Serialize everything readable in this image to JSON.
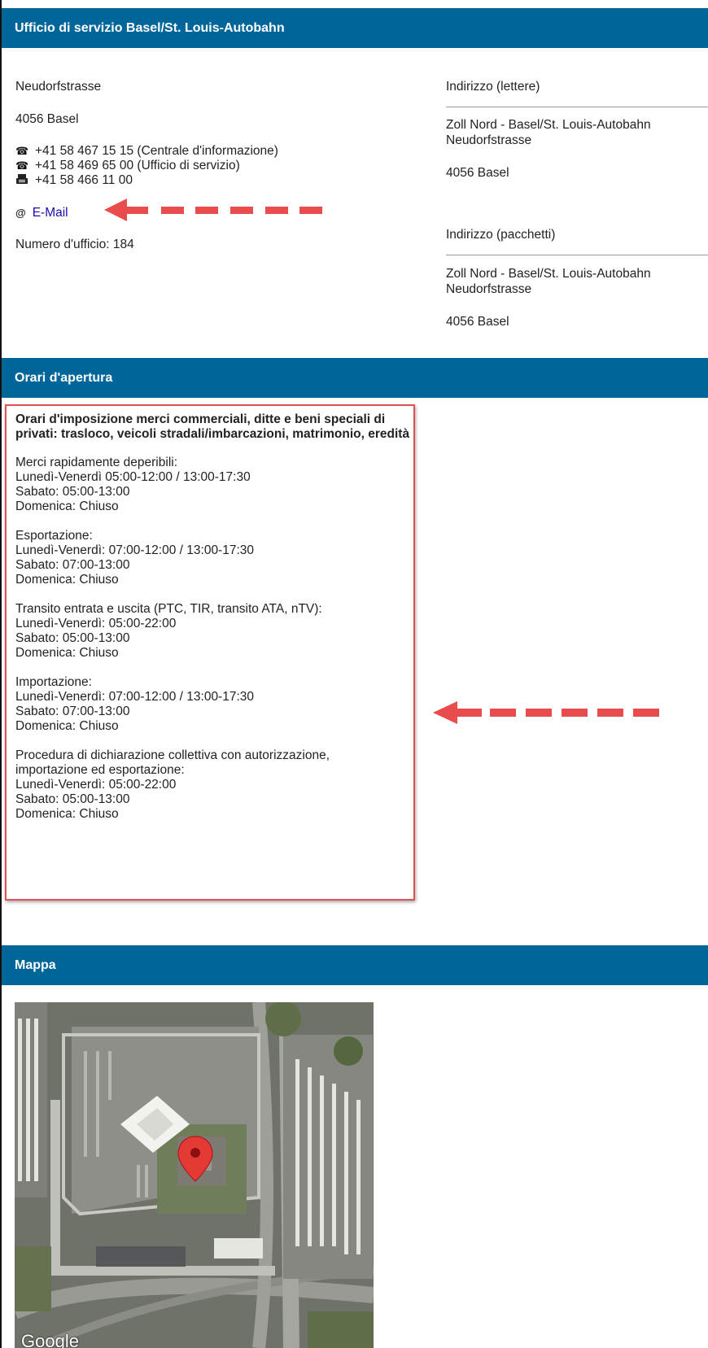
{
  "office_section": {
    "title": "Ufficio di servizio Basel/St. Louis-Autobahn",
    "street": "Neudorfstrasse",
    "city": "4056 Basel",
    "phones": [
      {
        "icon": "phone-icon",
        "text": "+41 58 467 15 15 (Centrale d'informazione)"
      },
      {
        "icon": "phone-icon",
        "text": "+41 58 469 65 00 (Ufficio di servizio)"
      },
      {
        "icon": "fax-icon",
        "text": "+41 58 466 11 00"
      }
    ],
    "email_symbol": "@",
    "email_label": "E-Mail",
    "office_number": "Numero d'ufficio: 184",
    "letters": {
      "title": "Indirizzo (lettere)",
      "line1": "Zoll Nord - Basel/St. Louis-Autobahn",
      "line2": "Neudorfstrasse",
      "line3": "4056 Basel"
    },
    "parcels": {
      "title": "Indirizzo (pacchetti)",
      "line1": "Zoll Nord - Basel/St. Louis-Autobahn",
      "line2": "Neudorfstrasse",
      "line3": "4056 Basel"
    }
  },
  "hours_section": {
    "title": "Orari d'apertura",
    "heading": "Orari d'imposizione merci commerciali, ditte e beni speciali di privati: trasloco, veicoli stradali/imbarcazioni, matrimonio, eredità",
    "blocks": [
      {
        "lines": [
          "Merci rapidamente deperibili:",
          "Lunedì-Venerdì 05:00-12:00 / 13:00-17:30",
          "Sabato: 05:00-13:00",
          "Domenica: Chiuso"
        ]
      },
      {
        "lines": [
          "Esportazione:",
          "Lunedì-Venerdì: 07:00-12:00 / 13:00-17:30",
          "Sabato: 07:00-13:00",
          "Domenica: Chiuso"
        ]
      },
      {
        "lines": [
          "Transito entrata e uscita (PTC, TIR, transito ATA, nTV):",
          "Lunedì-Venerdì: 05:00-22:00",
          "Sabato: 05:00-13:00",
          "Domenica: Chiuso"
        ]
      },
      {
        "lines": [
          "Importazione:",
          "Lunedì-Venerdì: 07:00-12:00 / 13:00-17:30",
          "Sabato: 07:00-13:00",
          "Domenica: Chiuso"
        ]
      },
      {
        "lines": [
          "Procedura di dichiarazione collettiva con autorizzazione,",
          "importazione ed esportazione:",
          "Lunedì-Venerdì: 05:00-22:00",
          "Sabato: 05:00-13:00",
          "Domenica: Chiuso"
        ]
      }
    ]
  },
  "map_section": {
    "title": "Mappa",
    "attribution": "Google"
  },
  "colors": {
    "header_bar": "#006699",
    "annotation_red": "#e84c4c",
    "link": "#1a0dab",
    "marker": "#e53935"
  },
  "icons": [
    "phone-icon",
    "fax-icon",
    "at-icon",
    "map-marker-icon",
    "arrow-left-icon"
  ]
}
